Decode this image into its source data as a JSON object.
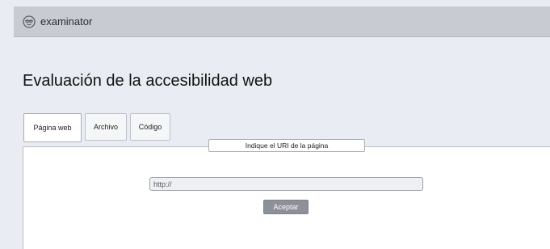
{
  "header": {
    "brand": "examinator",
    "logo_icon": "examinator-logo-icon"
  },
  "main": {
    "title": "Evaluación de la accesibilidad web",
    "tabs": [
      {
        "label": "Página web",
        "active": true
      },
      {
        "label": "Archivo",
        "active": false
      },
      {
        "label": "Código",
        "active": false
      }
    ],
    "form": {
      "legend": "Indique el URI de la página",
      "uri_value": "",
      "uri_placeholder": "http://",
      "submit_label": "Aceptar"
    }
  },
  "colors": {
    "page_background": "#e9edf3",
    "topbar": "#c8ccd2",
    "button": "#8c9199"
  }
}
